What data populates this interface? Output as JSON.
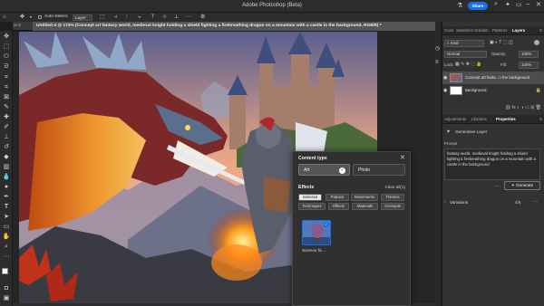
{
  "app": {
    "title": "Adobe Photoshop (Beta)",
    "share_label": "Share"
  },
  "options_bar": {
    "auto_select_label": "Auto-Select:",
    "auto_select_value": "Layer",
    "more": "···",
    "settings_icon": "gear-icon"
  },
  "tabs": {
    "left_fragment": "xt-2",
    "active": "Untitled-4 @ 174% (Concept art fantasy world, medieval knight holding a shield fighting a firebreathing dragon on a mountain with a castle in the background, RGB/8) *"
  },
  "toolbar": {
    "icons": [
      "move-icon",
      "artboard-icon",
      "marquee-icon",
      "lasso-icon",
      "object-select-icon",
      "crop-icon",
      "frame-icon",
      "eyedropper-icon",
      "healing-icon",
      "brush-icon",
      "stamp-icon",
      "history-brush-icon",
      "eraser-icon",
      "gradient-icon",
      "blur-icon",
      "dodge-icon",
      "pen-icon",
      "type-icon",
      "path-select-icon",
      "shape-icon",
      "hand-icon",
      "zoom-icon",
      "more-tools-icon",
      "foreground-color",
      "background-color",
      "quick-mask-icon",
      "screen-mode-icon"
    ]
  },
  "layers_panel": {
    "tabs": [
      "Color",
      "Swatches",
      "Gradien",
      "Patterns",
      "Layers"
    ],
    "active_tab": "Layers",
    "filter_value": "Kind",
    "blend_mode": "Normal",
    "opacity_label": "Opacity:",
    "opacity_value": "100%",
    "lock_label": "Lock:",
    "fill_label": "Fill:",
    "fill_value": "100%",
    "layers": [
      {
        "name": "Concept art fanta...n the background",
        "selected": true
      },
      {
        "name": "Background",
        "selected": false
      }
    ]
  },
  "properties_panel": {
    "tabs": [
      "Adjustments",
      "Libraries",
      "Properties"
    ],
    "active_tab": "Properties",
    "layer_type": "Generative Layer",
    "prompt_label": "Prompt",
    "prompt_text": "fantasy world, medieval knight holding a shield fighting a firebreathing dragon on a mountain with a castle in the background",
    "generate_label": "Generate",
    "variations_label": "Variations",
    "variations_count": "4/6"
  },
  "generate_popup": {
    "content_type_label": "Content type",
    "art_label": "Art",
    "photo_label": "Photo",
    "effects_label": "Effects",
    "clear_all_label": "Clear all(1)",
    "chips_row1": [
      "Selected",
      "Popular",
      "Movements",
      "Themes"
    ],
    "chips_row2": [
      "Techniques",
      "Effects",
      "Materials",
      "Concepts"
    ],
    "selected_effect": "Science fic..."
  },
  "colors": {
    "accent": "#1473e6",
    "panel": "#323232",
    "toolbar": "#2c2c2c"
  }
}
